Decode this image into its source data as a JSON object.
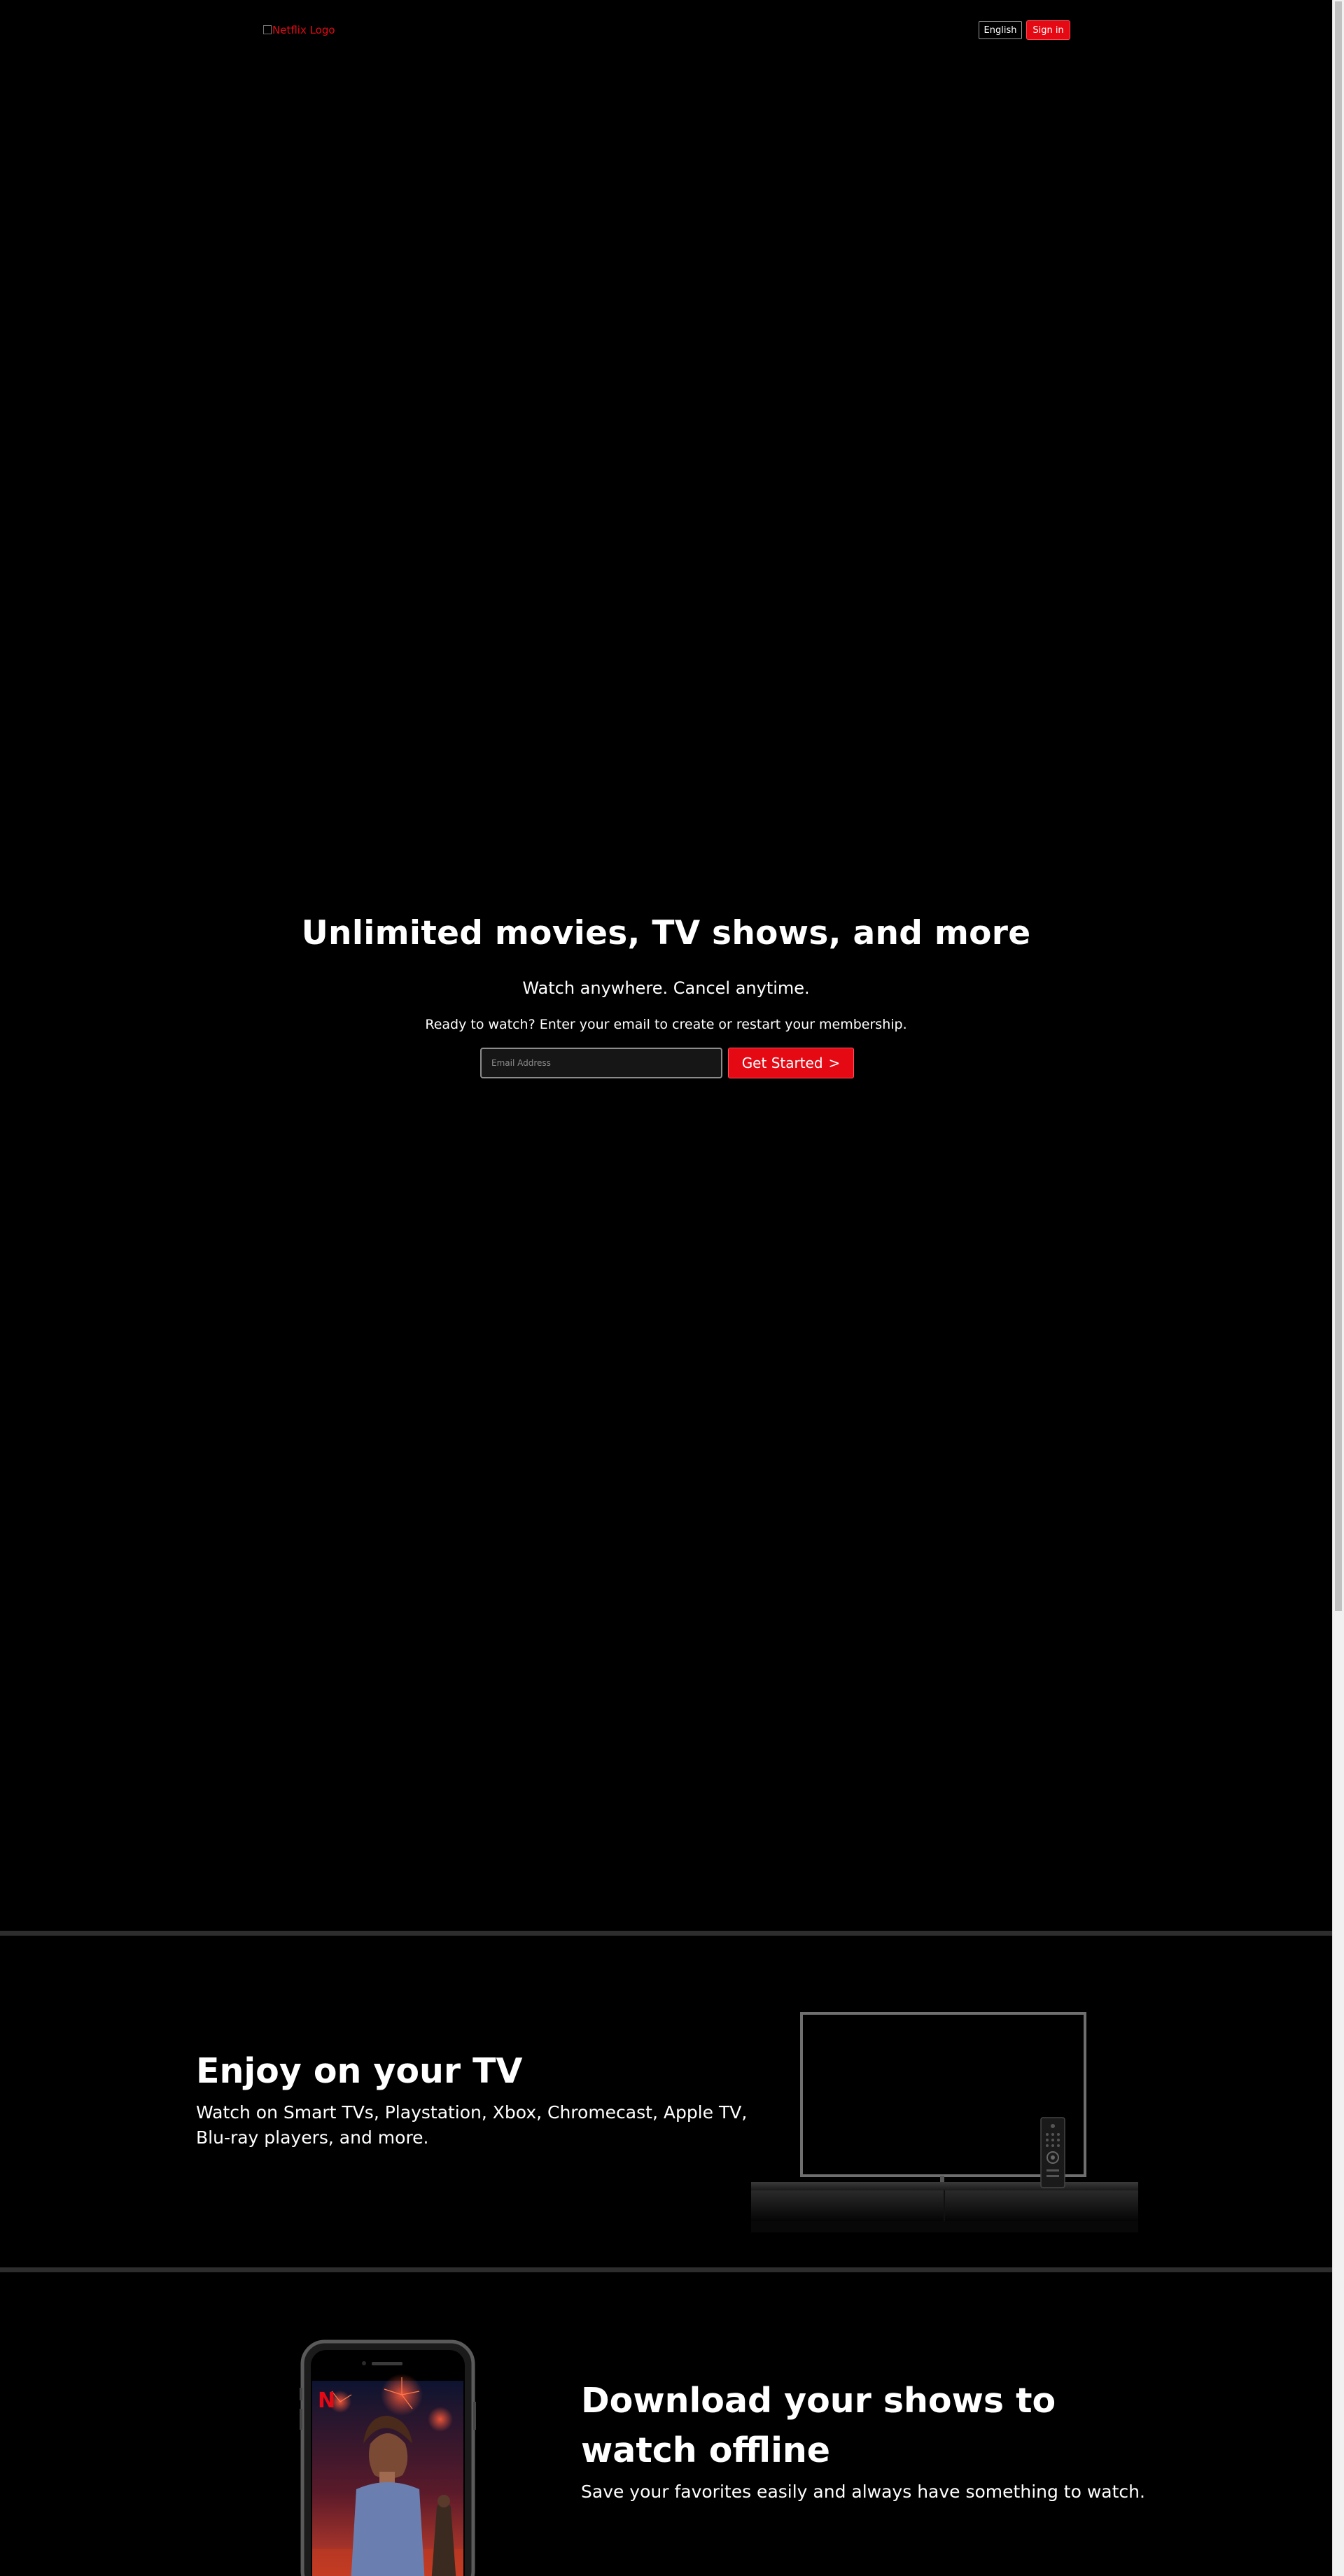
{
  "header": {
    "logo_alt": "Netflix Logo",
    "language_label": "English",
    "signin_label": "Sign in"
  },
  "hero": {
    "title": "Unlimited movies, TV shows, and more",
    "subtitle": "Watch anywhere. Cancel anytime.",
    "cta_text": "Ready to watch? Enter your email to create or restart your membership.",
    "email_placeholder": "Email Address",
    "email_value": "",
    "get_started_label": "Get Started",
    "get_started_chevron": ">"
  },
  "tv_section": {
    "title": "Enjoy on your TV",
    "description": "Watch on Smart TVs, Playstation, Xbox, Chromecast, Apple TV, Blu-ray players, and more."
  },
  "download_section": {
    "title": "Download your shows to watch offline",
    "description": "Save your favorites easily and always have something to watch."
  },
  "colors": {
    "background": "#000000",
    "brand_red": "#e50914",
    "divider": "#2d2d2d",
    "text": "#ffffff"
  },
  "icons": [
    "broken-image-icon",
    "tv-icon",
    "remote-icon",
    "phone-icon",
    "netflix-n-icon"
  ]
}
